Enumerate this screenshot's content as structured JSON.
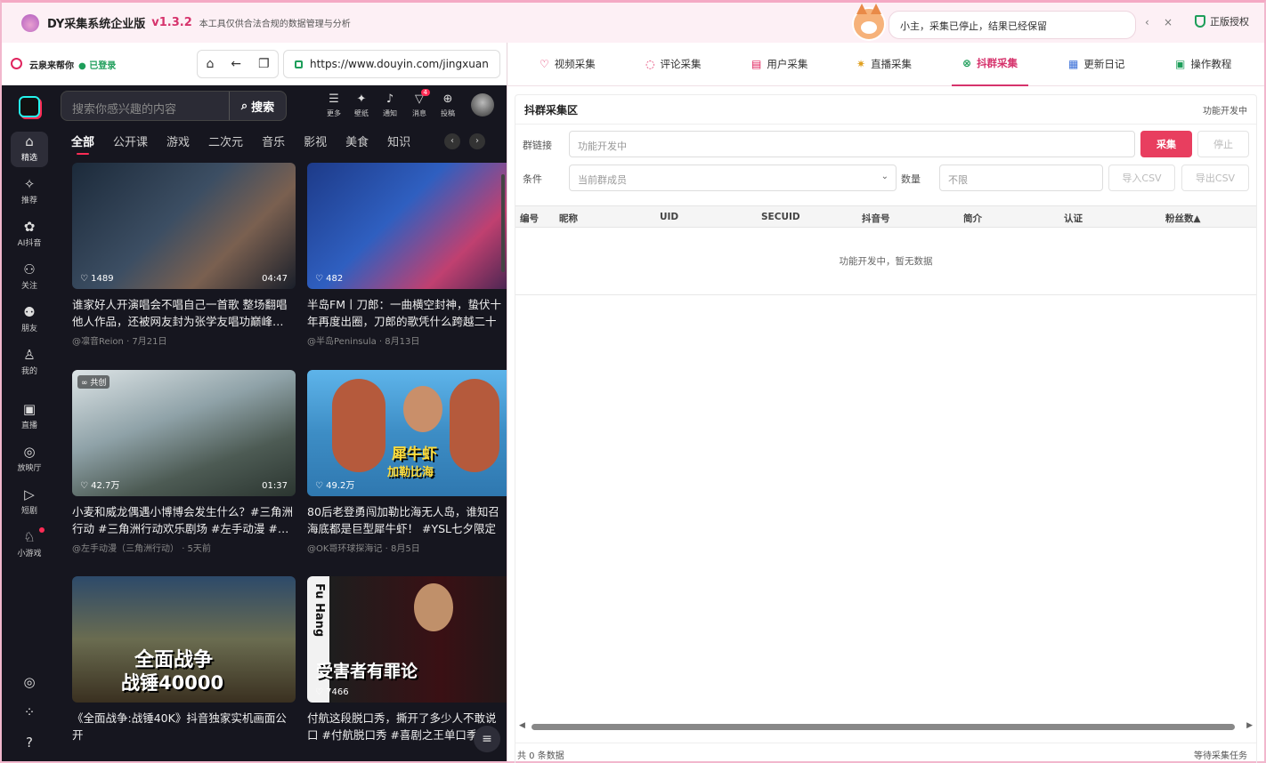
{
  "titlebar": {
    "app_name": "DY采集系统企业版",
    "version": "v1.3.2",
    "subtitle": "本工具仅供合法合规的数据管理与分析",
    "message": "小主，采集已停止，结果已经保留",
    "prev_icon": "‹",
    "close_icon": "×",
    "license_label": "正版授权"
  },
  "browser": {
    "user_name": "云泉来帮你",
    "login_status": "已登录",
    "url": "https://www.douyin.com/jingxuan"
  },
  "douyin": {
    "search_placeholder": "搜索你感兴趣的内容",
    "search_button": "搜索",
    "sidebar": [
      {
        "label": "精选",
        "icon": "home-icon"
      },
      {
        "label": "推荐",
        "icon": "sparkle-icon"
      },
      {
        "label": "AI抖音",
        "icon": "ai-icon"
      },
      {
        "label": "关注",
        "icon": "follow-icon"
      },
      {
        "label": "朋友",
        "icon": "friends-icon"
      },
      {
        "label": "我的",
        "icon": "profile-icon"
      },
      {
        "label": "直播",
        "icon": "tv-icon"
      },
      {
        "label": "放映厅",
        "icon": "film-icon"
      },
      {
        "label": "短剧",
        "icon": "play-icon"
      },
      {
        "label": "小游戏",
        "icon": "game-icon"
      }
    ],
    "top_icons": [
      {
        "label": "更多",
        "icon": "menu-icon"
      },
      {
        "label": "壁纸",
        "icon": "wallpaper-icon"
      },
      {
        "label": "通知",
        "icon": "bell-icon"
      },
      {
        "label": "消息",
        "icon": "message-icon",
        "badge": "4"
      },
      {
        "label": "投稿",
        "icon": "upload-icon"
      }
    ],
    "categories": [
      "全部",
      "公开课",
      "游戏",
      "二次元",
      "音乐",
      "影视",
      "美食",
      "知识"
    ],
    "cards": [
      {
        "likes": "♡ 1489",
        "duration": "04:47",
        "title": "谁家好人开演唱会不唱自己一首歌 整场翻唱他人作品，还被网友封为张学友唱功巅峰…",
        "author": "@凛音Reion",
        "date": "· 7月21日",
        "tag": ""
      },
      {
        "likes": "♡ 482",
        "duration": "",
        "title": "半岛FM丨刀郎：一曲横空封神，蛰伏十年再度出圈，刀郎的歌凭什么跨越二十年依",
        "author": "@半岛Peninsula",
        "date": "· 8月13日",
        "tag": ""
      },
      {
        "likes": "♡ 42.7万",
        "duration": "01:37",
        "title": "小麦和威龙偶遇小博博会发生什么？#三角洲行动 #三角洲行动欢乐剧场 #左手动漫 #…",
        "author": "@左手动漫（三角洲行动）",
        "date": "· 5天前",
        "tag": "共创"
      },
      {
        "likes": "♡ 49.2万",
        "duration": "",
        "title": "80后老登勇闯加勒比海无人岛，谁知召海底都是巨型犀牛虾！ #YSL七夕限定",
        "author": "@OK哥环球探海记",
        "date": "· 8月5日",
        "tag": "",
        "overlay1": "犀牛虾",
        "overlay2": "加勒比海"
      },
      {
        "likes": "",
        "duration": "",
        "title": "《全面战争:战锤40K》抖音独家实机画面公开",
        "author": "",
        "date": "",
        "tag": "",
        "overlay1": "全面战争",
        "overlay2": "战锤40000"
      },
      {
        "likes": "♡ 7466",
        "duration": "",
        "title": "付航这段脱口秀，撕开了多少人不敢说口 #付航脱口秀 #喜剧之王单口季",
        "author": "",
        "date": "",
        "tag": "",
        "overlay1": "受害者有罪论",
        "overlay2": "Fu Hang"
      }
    ]
  },
  "tabs": [
    {
      "label": "视频采集",
      "icon": "heart-icon"
    },
    {
      "label": "评论采集",
      "icon": "comment-icon"
    },
    {
      "label": "用户采集",
      "icon": "user-icon"
    },
    {
      "label": "直播采集",
      "icon": "live-icon"
    },
    {
      "label": "抖群采集",
      "icon": "group-icon",
      "active": true
    },
    {
      "label": "更新日记",
      "icon": "calendar-icon"
    },
    {
      "label": "操作教程",
      "icon": "guide-icon"
    }
  ],
  "panel": {
    "title": "抖群采集区",
    "status": "功能开发中",
    "link_label": "群链接",
    "link_placeholder": "功能开发中",
    "collect_button": "采集",
    "stop_button": "停止",
    "condition_label": "条件",
    "condition_value": "当前群成员",
    "count_label": "数量",
    "count_value": "不限",
    "import_button": "导入CSV",
    "export_button": "导出CSV",
    "columns": [
      "编号",
      "昵称",
      "UID",
      "SECUID",
      "抖音号",
      "简介",
      "认证",
      "粉丝数▲"
    ],
    "empty_text": "功能开发中，暂无数据",
    "footer_count": "共 0 条数据",
    "footer_status": "等待采集任务"
  },
  "colors": {
    "accent": "#d6336c",
    "primary_button": "#e83e5f",
    "ok": "#1e9e5a"
  }
}
